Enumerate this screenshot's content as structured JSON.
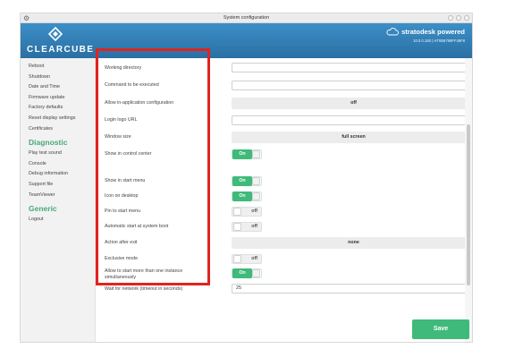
{
  "window": {
    "title": "System configuration",
    "app_icon": "gear-icon"
  },
  "header": {
    "logo_text": "CLEARCUBE",
    "brand_name": "stratodesk powered",
    "brand_sub": "10.0.0.160 | HT0B6798FF46F8",
    "brand_icon": "cloud-icon"
  },
  "sidebar": {
    "items": [
      {
        "label": "Reboot"
      },
      {
        "label": "Shutdown"
      },
      {
        "label": "Date and Time"
      },
      {
        "label": "Firmware update"
      },
      {
        "label": "Factory defaults"
      },
      {
        "label": "Reset display settings"
      },
      {
        "label": "Certificates"
      }
    ],
    "diagnostic_title": "Diagnostic",
    "diagnostic_items": [
      {
        "label": "Play test sound"
      },
      {
        "label": "Console"
      },
      {
        "label": "Debug information"
      },
      {
        "label": "Support file"
      },
      {
        "label": "TeamViewer"
      }
    ],
    "generic_title": "Generic",
    "generic_items": [
      {
        "label": "Logout"
      }
    ]
  },
  "form": {
    "working_directory": {
      "label": "Working directory",
      "value": ""
    },
    "command": {
      "label": "Command to be executed",
      "value": ""
    },
    "allow_in_app_config": {
      "label": "Allow in-application configuration",
      "value": "off"
    },
    "login_logo_url": {
      "label": "Login logo URL",
      "value": ""
    },
    "window_size": {
      "label": "Window size",
      "value": "full screen"
    },
    "show_in_control_center": {
      "label": "Show in control center",
      "state": "On"
    },
    "show_in_start_menu": {
      "label": "Show in start menu",
      "state": "On"
    },
    "icon_on_desktop": {
      "label": "Icon on desktop",
      "state": "On"
    },
    "pin_to_start_menu": {
      "label": "Pin to start menu",
      "state": "off"
    },
    "auto_start": {
      "label": "Automatic start at system boot",
      "state": "off"
    },
    "action_after_exit": {
      "label": "Action after exit",
      "value": "none"
    },
    "exclusive_mode": {
      "label": "Exclusive mode",
      "state": "off"
    },
    "allow_multiple_instances": {
      "label": "Allow to start more than one instance simultaneously",
      "state": "On"
    },
    "wait_for_network": {
      "label": "Wait for network (timeout in seconds)",
      "value": "25"
    }
  },
  "save_label": "Save",
  "colors": {
    "header": "#2f7db5",
    "accent": "#3fba7a",
    "section": "#48a979",
    "highlight": "#e0231f"
  }
}
